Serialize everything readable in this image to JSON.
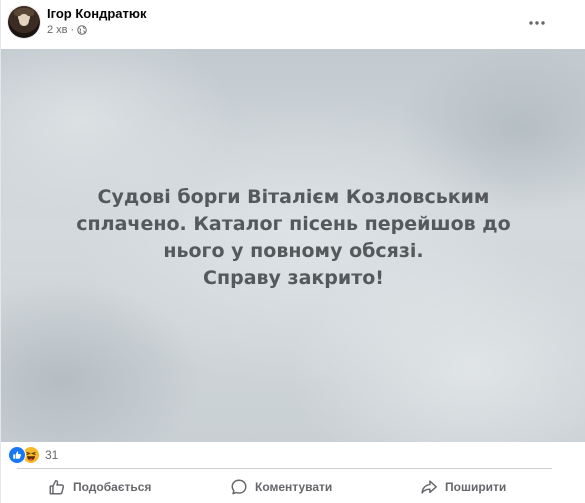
{
  "post": {
    "author": "Ігор Кондратюк",
    "time": "2 хв",
    "separator": "·",
    "image_text_lines": [
      "Судові борги Віталієм Козловським",
      "сплачено. Каталог пісень перейшов до",
      "нього у повному обсязі.",
      "Справу закрито!"
    ],
    "reactions": {
      "icons": [
        "like-reaction-icon",
        "haha-reaction-icon"
      ],
      "count": "31"
    },
    "actions": {
      "like_label": "Подобається",
      "comment_label": "Коментувати",
      "share_label": "Поширити"
    }
  },
  "colors": {
    "like_blue": "#1877f2",
    "haha_yellow": "#f7b928",
    "secondary_text": "#65676b",
    "image_text": "#56595b"
  }
}
